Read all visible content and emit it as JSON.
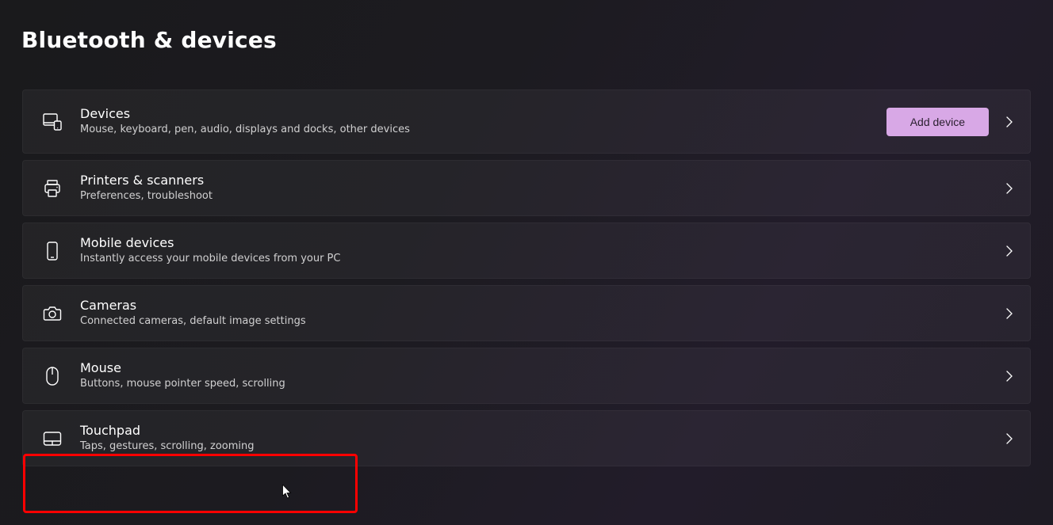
{
  "pageTitle": "Bluetooth & devices",
  "addDeviceLabel": "Add device",
  "rows": [
    {
      "title": "Devices",
      "subtitle": "Mouse, keyboard, pen, audio, displays and docks, other devices"
    },
    {
      "title": "Printers & scanners",
      "subtitle": "Preferences, troubleshoot"
    },
    {
      "title": "Mobile devices",
      "subtitle": "Instantly access your mobile devices from your PC"
    },
    {
      "title": "Cameras",
      "subtitle": "Connected cameras, default image settings"
    },
    {
      "title": "Mouse",
      "subtitle": "Buttons, mouse pointer speed, scrolling"
    },
    {
      "title": "Touchpad",
      "subtitle": "Taps, gestures, scrolling, zooming"
    }
  ]
}
